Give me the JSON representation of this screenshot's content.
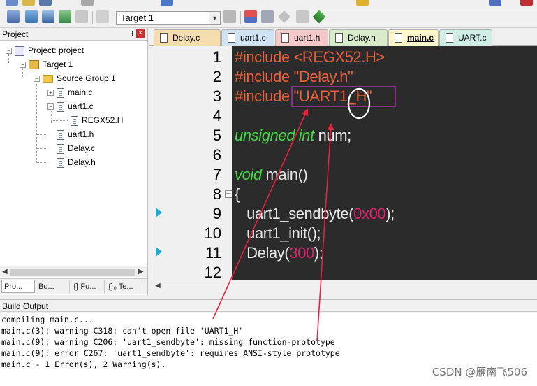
{
  "toolbar": {
    "target_value": "Target 1"
  },
  "project_panel": {
    "title": "Project",
    "pin_glyph": "ᵼ",
    "close_glyph": "×",
    "tree": [
      {
        "label": "Project: project",
        "icon": "project-icon"
      },
      {
        "label": "Target 1",
        "icon": "target-icon"
      },
      {
        "label": "Source Group 1",
        "icon": "folder-icon"
      },
      {
        "label": "main.c",
        "icon": "file-icon"
      },
      {
        "label": "uart1.c",
        "icon": "file-icon"
      },
      {
        "label": "REGX52.H",
        "icon": "file-icon"
      },
      {
        "label": "uart1.h",
        "icon": "file-icon"
      },
      {
        "label": "Delay.c",
        "icon": "file-icon"
      },
      {
        "label": "Delay.h",
        "icon": "file-icon"
      }
    ],
    "tabs": [
      "Pro...",
      "Bo...",
      "{} Fu...",
      "{}₀ Te..."
    ]
  },
  "editor": {
    "tabs": [
      {
        "label": "Delay.c",
        "color": "#f5ddb0"
      },
      {
        "label": "uart1.c",
        "color": "#cfe3f5"
      },
      {
        "label": "uart1.h",
        "color": "#f5c9c9"
      },
      {
        "label": "Delay.h",
        "color": "#d9ecc9"
      },
      {
        "label": "main.c",
        "color": "#fff6c9",
        "active": true
      },
      {
        "label": "UART.c",
        "color": "#cfeee8"
      }
    ],
    "line_numbers": [
      "1",
      "2",
      "3",
      "4",
      "5",
      "6",
      "7",
      "8",
      "9",
      "10",
      "11",
      "12"
    ],
    "lines": [
      [
        {
          "t": "#include <REGX52.H>",
          "c": "pp"
        }
      ],
      [
        {
          "t": "#include \"Delay.h\"",
          "c": "pp"
        }
      ],
      [
        {
          "t": "#include ",
          "c": "pp"
        },
        {
          "t": "\"UART1_H\"",
          "c": "pp"
        }
      ],
      [],
      [
        {
          "t": "unsigned int",
          "c": "kw"
        },
        {
          "t": " num;",
          "c": ""
        }
      ],
      [],
      [
        {
          "t": "void",
          "c": "kw"
        },
        {
          "t": " main()",
          "c": ""
        }
      ],
      [
        {
          "t": "{",
          "c": ""
        }
      ],
      [
        {
          "t": "   uart1_sendbyte(",
          "c": ""
        },
        {
          "t": "0x00",
          "c": "num"
        },
        {
          "t": ");",
          "c": ""
        }
      ],
      [
        {
          "t": "   uart1_init();",
          "c": ""
        }
      ],
      [
        {
          "t": "   Delay(",
          "c": ""
        },
        {
          "t": "300",
          "c": "num"
        },
        {
          "t": ");",
          "c": ""
        }
      ],
      []
    ]
  },
  "build_output": {
    "title": "Build Output",
    "lines": [
      "compiling main.c...",
      "main.c(3): warning C318: can't open file 'UART1_H'",
      "main.c(9): warning C206: 'uart1_sendbyte': missing function-prototype",
      "main.c(9): error C267: 'uart1_sendbyte': requires ANSI-style prototype",
      "main.c - 1 Error(s), 2 Warning(s)."
    ]
  },
  "watermark": "CSDN @雁南飞506",
  "colors": {
    "editor_bg": "#2b2b2b",
    "preprocessor": "#e8603c",
    "keyword": "#46d846",
    "number": "#e0206e",
    "annotation": "#e8203c",
    "highlight_box": "#cc33cc"
  }
}
